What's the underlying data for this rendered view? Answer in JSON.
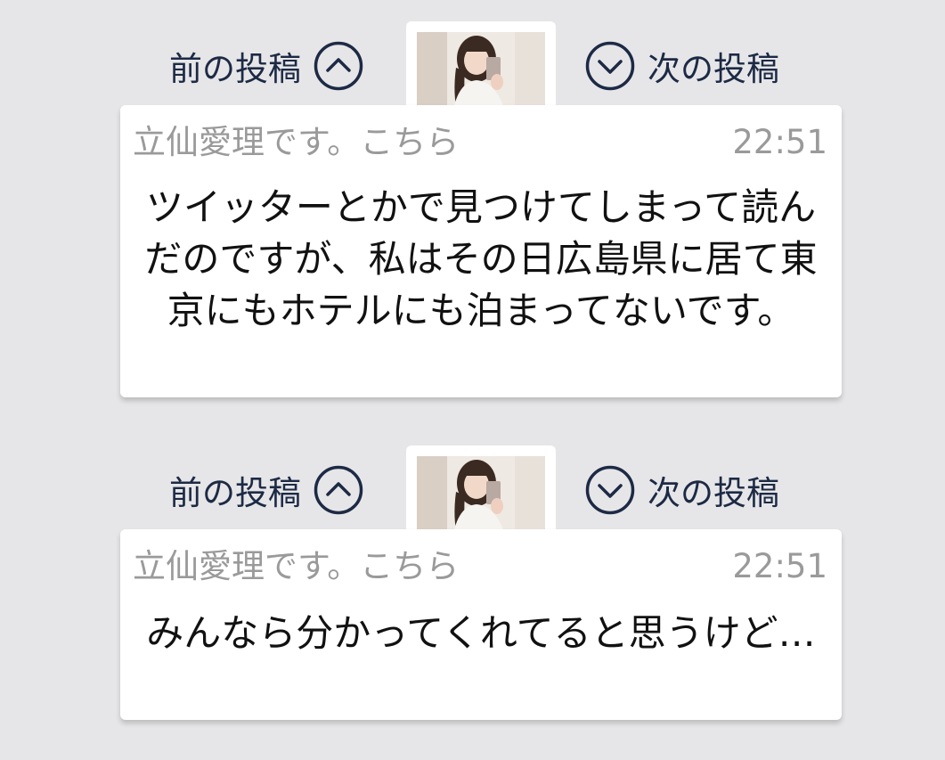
{
  "posts": [
    {
      "nav": {
        "prev_label": "前の投稿",
        "prev_icon": "chevron-up-circle-icon",
        "next_label": "次の投稿",
        "next_icon": "chevron-down-circle-icon"
      },
      "sender": "立仙愛理です。こちら",
      "time": "22:51",
      "message": "ツイッターとかで見つけてしまって読んだのですが、私はその日広島県に居て東京にもホテルにも泊まってないです。"
    },
    {
      "nav": {
        "prev_label": "前の投稿",
        "prev_icon": "chevron-up-circle-icon",
        "next_label": "次の投稿",
        "next_icon": "chevron-down-circle-icon"
      },
      "sender": "立仙愛理です。こちら",
      "time": "22:51",
      "message": "みんなら分かってくれてると思うけど…"
    }
  ],
  "colors": {
    "background": "#e6e6e8",
    "nav_text": "#1d2a45",
    "meta_text": "#9a9a9a",
    "message_text": "#111111",
    "card": "#ffffff"
  }
}
